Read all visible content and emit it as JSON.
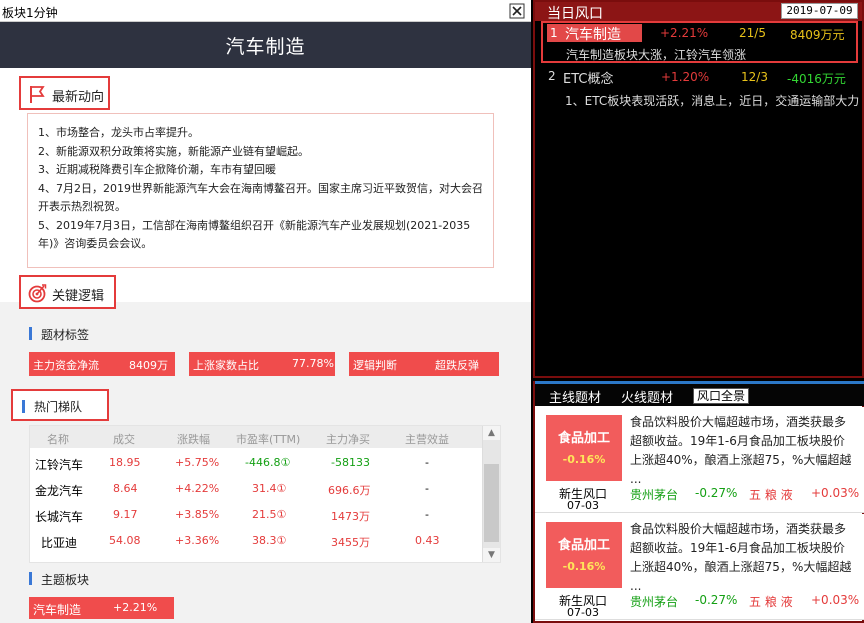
{
  "window": {
    "title": "板块1分钟"
  },
  "header": {
    "title": "汽车制造"
  },
  "news": {
    "section_title": "最新动向",
    "items": [
      "1、市场整合，龙头市占率提升。",
      "2、新能源双积分政策将实施，新能源产业链有望崛起。",
      "3、近期减税降费引车企掀降价潮，车市有望回暖",
      "4、7月2日，2019世界新能源汽车大会在海南博鳌召开。国家主席习近平致贺信，对大会召开表示热烈祝贺。",
      "5、2019年7月3日，工信部在海南博鳌组织召开《新能源汽车产业发展规划(2021-2035年)》咨询委员会会议。"
    ]
  },
  "logic": {
    "section_title": "关键逻辑",
    "tags_title": "题材标签",
    "tags": [
      {
        "label": "主力资金净流",
        "value": "8409万"
      },
      {
        "label": "上涨家数占比",
        "value": "77.78%"
      },
      {
        "label": "逻辑判断",
        "value": "超跌反弹"
      }
    ]
  },
  "ladder": {
    "section_title": "热门梯队",
    "columns": [
      "名称",
      "成交",
      "涨跌幅",
      "市盈率(TTM)",
      "主力净买",
      "主营效益"
    ],
    "rows": [
      {
        "name": "江铃汽车",
        "price": "18.95",
        "change": "+5.75%",
        "pe": "-446.8①",
        "net": "-58133",
        "eff": "-"
      },
      {
        "name": "金龙汽车",
        "price": "8.64",
        "change": "+4.22%",
        "pe": "31.4①",
        "net": "696.6万",
        "eff": "-"
      },
      {
        "name": "长城汽车",
        "price": "9.17",
        "change": "+3.85%",
        "pe": "21.5①",
        "net": "1473万",
        "eff": "-"
      },
      {
        "name": "比亚迪",
        "price": "54.08",
        "change": "+3.36%",
        "pe": "38.3①",
        "net": "3455万",
        "eff": "0.43"
      }
    ]
  },
  "theme": {
    "section_title": "主题板块",
    "chip_name": "汽车制造",
    "chip_change": "+2.21%"
  },
  "wind": {
    "title": "当日风口",
    "date": "2019-07-09",
    "items": [
      {
        "rank": "1",
        "name": "汽车制造",
        "change": "+2.21%",
        "ratio": "21/5",
        "flow": "8409万元",
        "desc": "汽车制造板块大涨，江铃汽车领涨"
      },
      {
        "rank": "2",
        "name": "ETC概念",
        "change": "+1.20%",
        "ratio": "12/3",
        "flow": "-4016万元",
        "desc": "1、ETC板块表现活跃，消息上，近日，交通运输部大力..."
      }
    ]
  },
  "themes_panel": {
    "tabs": [
      "主线题材",
      "火线题材",
      "风口全景"
    ],
    "selected_tab": 2,
    "cards": [
      {
        "name": "食品加工",
        "change": "-0.16%",
        "source": "新生风口",
        "date": "07-03",
        "desc": "食品饮料股价大幅超越市场，酒类获最多超额收益。19年1-6月食品加工板块股价上涨超40%，酿酒上涨超75，%大幅超越 ...",
        "stocks": [
          {
            "name": "贵州茅台",
            "change": "-0.27%"
          },
          {
            "name": "五 粮 液",
            "change": "+0.03%"
          }
        ]
      },
      {
        "name": "食品加工",
        "change": "-0.16%",
        "source": "新生风口",
        "date": "07-03",
        "desc": "食品饮料股价大幅超越市场，酒类获最多超额收益。19年1-6月食品加工板块股价上涨超40%，酿酒上涨超75，%大幅超越 ...",
        "stocks": [
          {
            "name": "贵州茅台",
            "change": "-0.27%"
          },
          {
            "name": "五 粮 液",
            "change": "+0.03%"
          }
        ]
      }
    ]
  },
  "colors": {
    "accent_red": "#e43b3b",
    "up_red": "#e43b3b",
    "down_green": "#14a014",
    "header_dark": "#2e3240",
    "wind_header": "#8c1515",
    "tab_blue": "#2c78c8"
  },
  "icons": {
    "close": "close-icon",
    "news": "flag-icon",
    "logic": "target-icon"
  }
}
